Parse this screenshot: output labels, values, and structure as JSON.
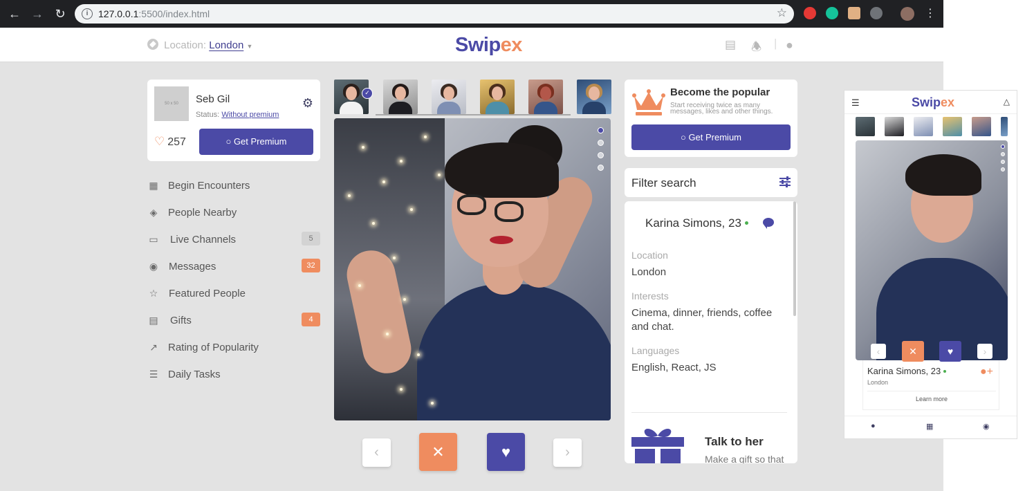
{
  "browser": {
    "url_host": "127.0.0.1",
    "url_path": ":5500/index.html"
  },
  "topbar": {
    "location_label": "Location:",
    "location_city": "London",
    "logo_part1": "Swip",
    "logo_part2": "ex"
  },
  "profile": {
    "avatar_placeholder": "50 x 50",
    "name": "Seb Gil",
    "status_label": "Status:",
    "status_value": "Without premium",
    "likes": "257",
    "premium_button": "Get Premium"
  },
  "menu": {
    "items": [
      {
        "label": "Begin Encounters",
        "icon": "grid-icon"
      },
      {
        "label": "People Nearby",
        "icon": "layers-icon"
      },
      {
        "label": "Live Channels",
        "icon": "monitor-icon",
        "badge": "5"
      },
      {
        "label": "Messages",
        "icon": "chat-icon",
        "badge": "32"
      },
      {
        "label": "Featured People",
        "icon": "star-icon"
      },
      {
        "label": "Gifts",
        "icon": "gift-icon",
        "badge": "4"
      },
      {
        "label": "Rating of Popularity",
        "icon": "chart-icon"
      },
      {
        "label": "Daily Tasks",
        "icon": "list-icon"
      }
    ]
  },
  "popular": {
    "title": "Become the popular",
    "text": "Start receiving twice as many messages, likes and other things.",
    "button": "Get Premium"
  },
  "filter": {
    "label": "Filter search"
  },
  "details": {
    "name": "Karina Simons, 23",
    "location_label": "Location",
    "location_value": "London",
    "interests_label": "Interests",
    "interests_value": "Cinema, dinner, friends, coffee and chat.",
    "languages_label": "Languages",
    "languages_value": "English, React, JS",
    "gift_title": "Talk to her",
    "gift_text": "Make a gift so that you can start chatting with her right away."
  },
  "mobile": {
    "logo_part1": "Swip",
    "logo_part2": "ex",
    "name": "Karina Simons, 23",
    "location": "London",
    "learn_more": "Learn more"
  },
  "colors": {
    "primary": "#4b4aa6",
    "accent": "#ef8c5f",
    "background": "#e3e3e3"
  }
}
